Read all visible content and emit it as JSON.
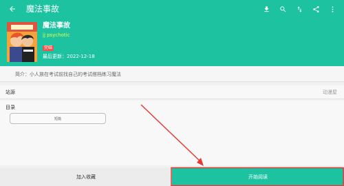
{
  "app": {
    "title": "魔法事故"
  },
  "toolbar": {
    "back_icon": "arrow-left-icon",
    "actions": [
      "download-icon",
      "search-icon",
      "sort-icon",
      "share-icon",
      "more-icon"
    ]
  },
  "comic": {
    "name": "魔法事故",
    "author": "jj psychotic",
    "status": "完结",
    "updated": "最后更新：2022-12-18",
    "description": "简介：小人族在考试前找自己的考试搭档练习魔法"
  },
  "sources": {
    "label": "站源",
    "value": "动漫屋"
  },
  "toc": {
    "label": "目录",
    "chapters": [
      "短篇"
    ]
  },
  "bottom": {
    "favorite": "加入收藏",
    "read": "开始阅读"
  },
  "colors": {
    "accent": "#1dc3a1",
    "highlight_border": "#e53935",
    "arrow": "#e53935"
  }
}
